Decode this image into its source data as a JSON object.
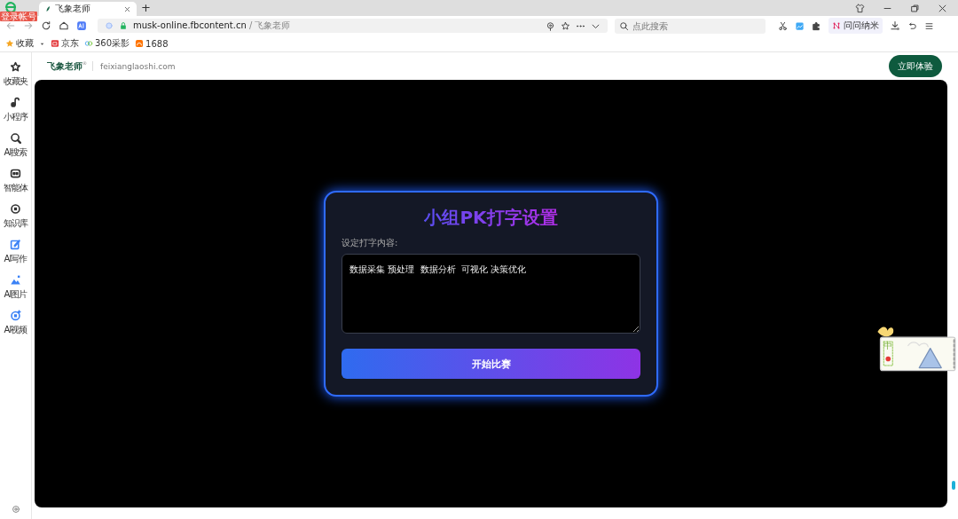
{
  "browser": {
    "badge": "登录帐号",
    "tab": {
      "title": "飞象老师",
      "selected": true
    },
    "new_tab": "+",
    "address": {
      "host": "musk-online.fbcontent.cn",
      "separator": "/",
      "page_title": "飞象老师"
    },
    "search": {
      "placeholder": "点此搜索"
    },
    "assistant": "问问纳米",
    "bookmarks": [
      {
        "label": "收藏",
        "kind": "star"
      },
      {
        "label": "京东",
        "kind": "shop"
      },
      {
        "label": "360采影",
        "kind": "cloud"
      },
      {
        "label": "1688",
        "kind": "market"
      }
    ]
  },
  "sidebar": {
    "items": [
      {
        "label": "收藏夹",
        "kind": "star",
        "color": "#333333"
      },
      {
        "label": "小程序",
        "kind": "link",
        "color": "#333333"
      },
      {
        "label": "AI搜索",
        "kind": "search",
        "color": "#333333"
      },
      {
        "label": "智能体",
        "kind": "bot",
        "color": "#333333"
      },
      {
        "label": "知识库",
        "kind": "target",
        "color": "#333333"
      },
      {
        "label": "AI写作",
        "kind": "write",
        "color": "#3b82f6"
      },
      {
        "label": "AI图片",
        "kind": "image",
        "color": "#3b82f6"
      },
      {
        "label": "AI视频",
        "kind": "video",
        "color": "#3b82f6"
      }
    ]
  },
  "site_header": {
    "logo": "飞象老师",
    "mark": "®",
    "domain": "feixianglaoshi.com",
    "cta": "立即体验"
  },
  "card": {
    "title": "小组PK打字设置",
    "field_label": "设定打字内容:",
    "text_value": "数据采集 预处理  数据分析  可视化 决策优化",
    "start_button": "开始比赛"
  },
  "widget": {
    "glyph": "中"
  }
}
